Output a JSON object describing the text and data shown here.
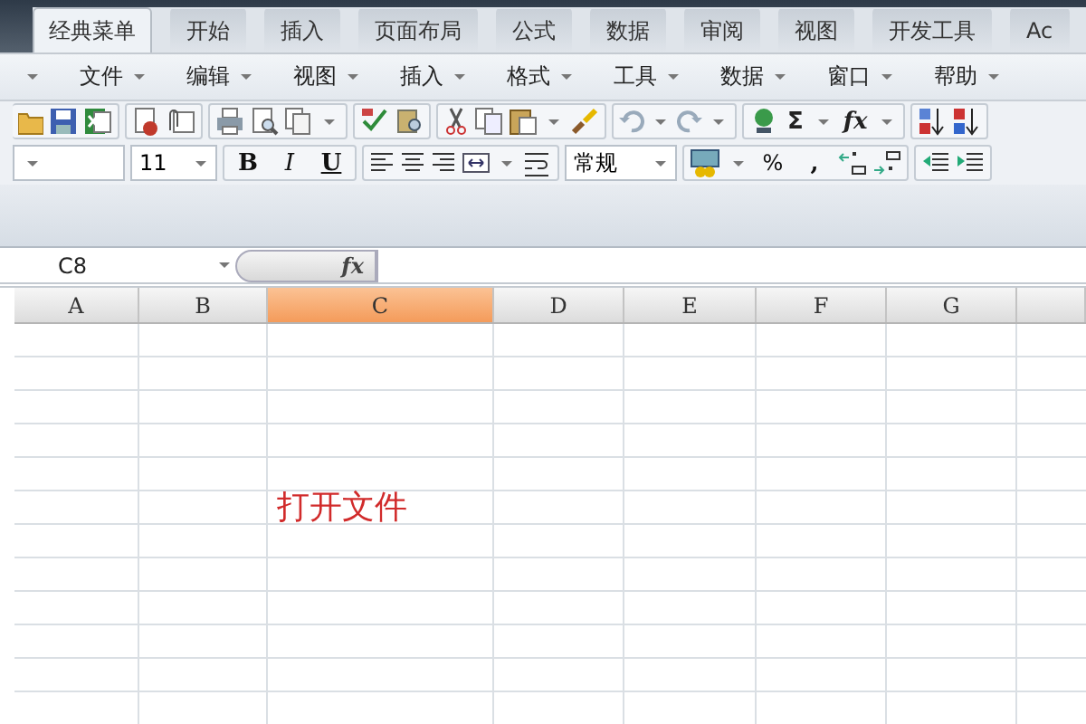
{
  "ribbon_tabs": [
    {
      "label": "经典菜单",
      "selected": true
    },
    {
      "label": "开始",
      "selected": false
    },
    {
      "label": "插入",
      "selected": false
    },
    {
      "label": "页面布局",
      "selected": false
    },
    {
      "label": "公式",
      "selected": false
    },
    {
      "label": "数据",
      "selected": false
    },
    {
      "label": "审阅",
      "selected": false
    },
    {
      "label": "视图",
      "selected": false
    },
    {
      "label": "开发工具",
      "selected": false
    },
    {
      "label": "Ac",
      "selected": false
    }
  ],
  "menu": [
    "文件",
    "编辑",
    "视图",
    "插入",
    "格式",
    "工具",
    "数据",
    "窗口",
    "帮助"
  ],
  "toolbar": {
    "sum": "Σ",
    "function": "fx"
  },
  "format_bar": {
    "font_size": "11",
    "bold": "B",
    "italic": "I",
    "underline": "U",
    "number_format": "常规",
    "percent": "%",
    "comma": ","
  },
  "formula_bar": {
    "name_box": "C8",
    "fx": "fx"
  },
  "sheet": {
    "columns": [
      {
        "label": "A",
        "selected": false
      },
      {
        "label": "B",
        "selected": false
      },
      {
        "label": "C",
        "selected": true
      },
      {
        "label": "D",
        "selected": false
      },
      {
        "label": "E",
        "selected": false
      },
      {
        "label": "F",
        "selected": false
      },
      {
        "label": "G",
        "selected": false
      }
    ],
    "cell_text": "打开文件"
  }
}
